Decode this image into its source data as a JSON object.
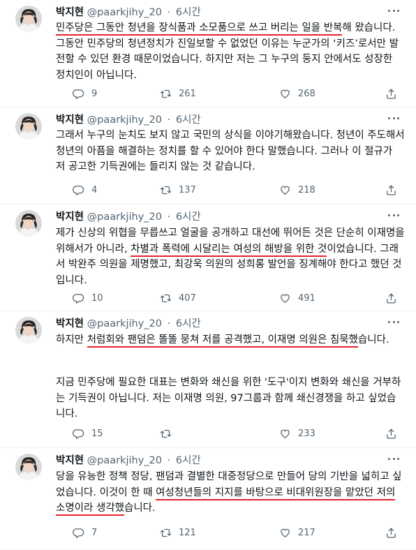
{
  "colors": {
    "text": "#0f1419",
    "meta": "#536471",
    "highlight": "#e8202a"
  },
  "icons": [
    "reply-icon",
    "retweet-icon",
    "like-icon",
    "share-icon",
    "more-icon"
  ],
  "tweets": [
    {
      "name": "박지현",
      "handle": "@paarkjihy_20",
      "sep": "·",
      "time": "6시간",
      "p1": {
        "pre": "",
        "hl": "민주당은 그동안 청년을 장식품과 소모품으로 쓰고 버리는 일을 반복",
        "post": "해 왔습니다. 그동안 민주당의 청년정치가 진일보할 수 없었던 이유는 누군가의 ‘키즈’로서만 발전할 수 있던 환경 때문이었습니다. 하지만 저는 그 누구의 둥지 안에서도 성장한 정치인이 아닙니다."
      },
      "replies": "9",
      "retweets": "261",
      "likes": "268"
    },
    {
      "name": "박지현",
      "handle": "@paarkjihy_20",
      "sep": "·",
      "time": "6시간",
      "p1": {
        "pre": "그래서 누구의 눈치도 보지 않고 국민의 상식을 이야기해왔습니다. 청년이 주도해서 청년의 아픔을 해결하는 정치를 할 수 있어야 한다 말했습니다. 그러나 이 절규가 저 공고한 기득권에는 들리지 않는 것 같습니다.",
        "hl": "",
        "post": ""
      },
      "replies": "4",
      "retweets": "137",
      "likes": "218"
    },
    {
      "name": "박지현",
      "handle": "@paarkjihy_20",
      "sep": "·",
      "time": "6시간",
      "p1": {
        "pre": "제가 신상의 위협을 무릅쓰고 얼굴을 공개하고 대선에 뛰어든 것은 단순히 이재명을 위해서가 아니라, ",
        "hl": "차별과 폭력에 시달리는 여성의 해방을 위한 것",
        "post": "이었습니다. 그래서 박완주 의원을 제명했고, 최강욱 의원의 성희롱 발언을 징계해야 한다고 했던 것입니다."
      },
      "replies": "10",
      "retweets": "407",
      "likes": "491"
    },
    {
      "name": "박지현",
      "handle": "@paarkjihy_20",
      "sep": "·",
      "time": "6시간",
      "p1": {
        "pre": "하지만 ",
        "hl": "처럼회와 팬덤은 똘똘 뭉쳐 저를 공격했고, 이재명 의원은 침묵했",
        "post": "습니다."
      },
      "p2": "지금 민주당에 필요한 대표는 변화와 쇄신을 위한 '도구'이지 변화와 쇄신을 거부하는 기득권이 아닙니다. 저는 이재명 의원, 97그룹과 함께 쇄신경쟁을 하고 싶었습니다.",
      "replies": "15",
      "retweets": "",
      "likes": "233"
    },
    {
      "name": "박지현",
      "handle": "@paarkjihy_20",
      "sep": "·",
      "time": "6시간",
      "p1": {
        "pre": "당을 유능한 정책 정당, 팬덤과 결별한 대중정당으로 만들어 당의 기반을 넓히고 싶었습니다. 이것이 한 때 ",
        "hl": "여성청년들의 지지를 바탕으로 비대위원장을 맡았던 저의 소명이라 생각했",
        "post": "습니다."
      },
      "replies": "7",
      "retweets": "121",
      "likes": "217"
    }
  ]
}
